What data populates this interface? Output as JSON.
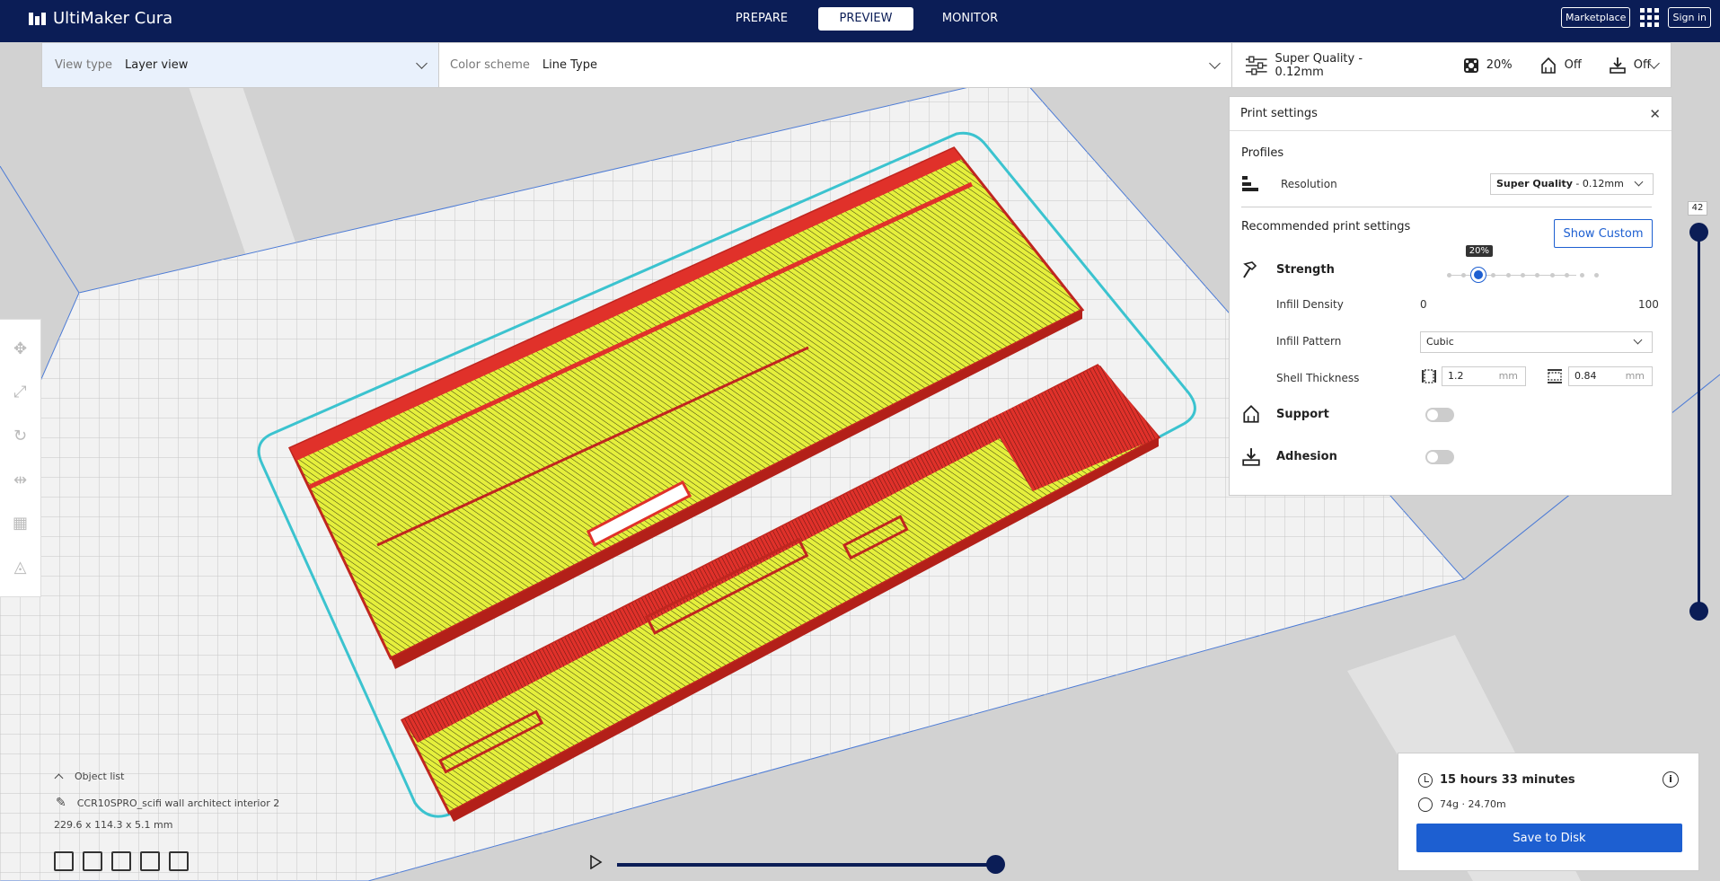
{
  "app": {
    "title": "UltiMaker Cura"
  },
  "stages": [
    {
      "label": "PREPARE",
      "active": false
    },
    {
      "label": "PREVIEW",
      "active": true
    },
    {
      "label": "MONITOR",
      "active": false
    }
  ],
  "topbar": {
    "marketplace": "Marketplace",
    "signin": "Sign in"
  },
  "header": {
    "view_type_label": "View type",
    "view_type_value": "Layer view",
    "color_scheme_label": "Color scheme",
    "color_scheme_value": "Line Type",
    "profile": "Super Quality - 0.12mm",
    "infill": "20%",
    "support": "Off",
    "adhesion": "Off"
  },
  "print_settings": {
    "title": "Print settings",
    "profiles": "Profiles",
    "resolution_label": "Resolution",
    "resolution_bold": "Super Quality",
    "resolution_rest": " - 0.12mm",
    "recommended": "Recommended print settings",
    "show_custom": "Show Custom",
    "strength": "Strength",
    "infill_density_label": "Infill Density",
    "infill_min": "0",
    "infill_max": "100",
    "infill_value": 20,
    "infill_tip": "20%",
    "infill_pattern_label": "Infill Pattern",
    "infill_pattern_value": "Cubic",
    "shell_label": "Shell Thickness",
    "shell_wall": "1.2",
    "shell_top": "0.84",
    "unit": "mm",
    "support": "Support",
    "adhesion": "Adhesion"
  },
  "layer": {
    "current": "42"
  },
  "object": {
    "list_label": "Object list",
    "name": "CCR10SPRO_scifi wall architect interior 2",
    "dims": "229.6 x 114.3 x 5.1 mm"
  },
  "job": {
    "time": "15 hours 33 minutes",
    "material": "74g · 24.70m",
    "save": "Save to Disk"
  },
  "colors": {
    "navy": "#0b1d56",
    "accent": "#1d5fd1",
    "infill": "#e5ef3c",
    "wall": "#e0312a",
    "skirt": "#3bc3cf"
  }
}
